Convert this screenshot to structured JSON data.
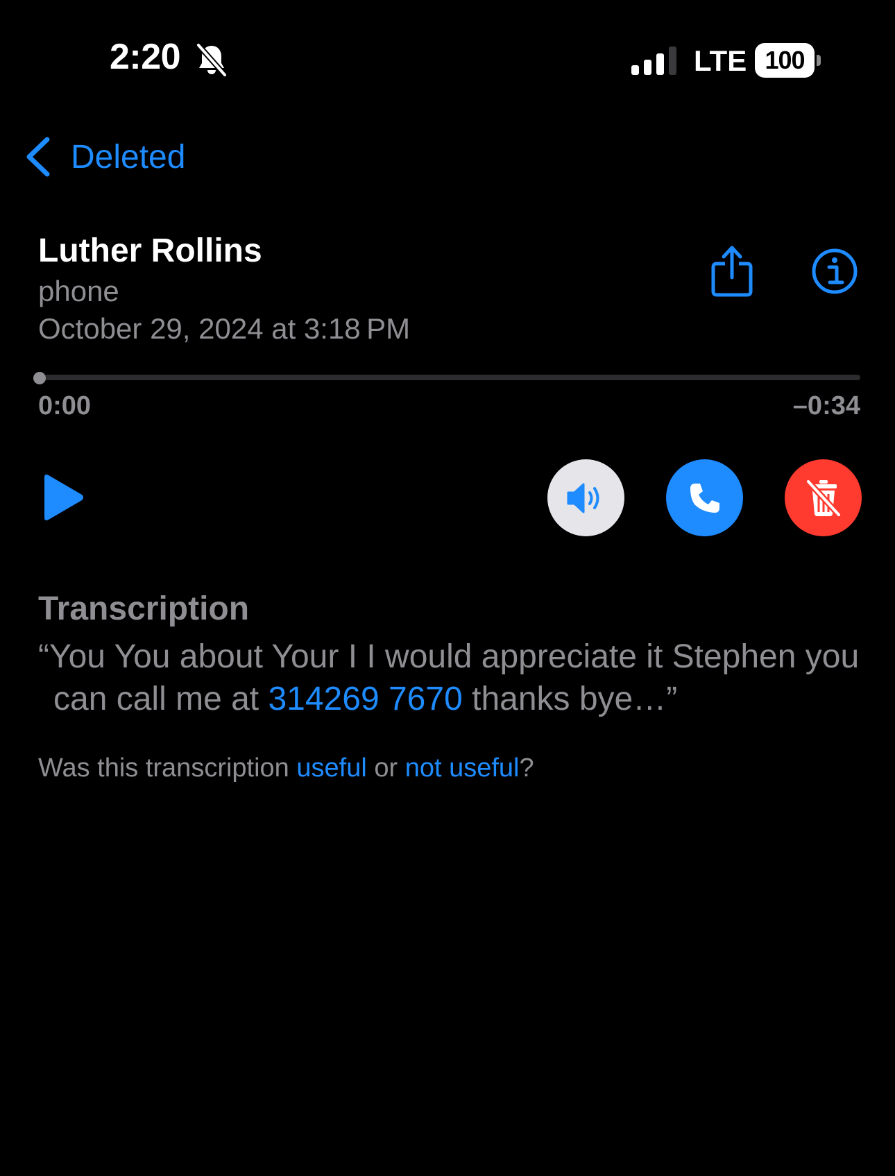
{
  "status_bar": {
    "time": "2:20",
    "network": "LTE",
    "battery": "100",
    "icons": [
      "bell-slash-icon",
      "signal-icon",
      "battery-icon"
    ]
  },
  "nav": {
    "back_label": "Deleted",
    "back_icon": "chevron-left-icon"
  },
  "voicemail": {
    "caller_name": "Luther Rollins",
    "label": "phone",
    "datetime": "October 29, 2024 at 3:18 PM",
    "actions": [
      "share-icon",
      "info-icon"
    ]
  },
  "player": {
    "elapsed": "0:00",
    "remaining": "–0:34",
    "progress": 0,
    "play_icon": "play-icon"
  },
  "controls": {
    "speaker": {
      "icon": "speaker-icon",
      "bg": "#e5e5ea",
      "fg": "#1e8bff"
    },
    "call": {
      "icon": "phone-icon",
      "bg": "#1e8bff",
      "fg": "#ffffff"
    },
    "delete": {
      "icon": "trash-slash-icon",
      "bg": "#ff3b30",
      "fg": "#ffffff"
    }
  },
  "transcription": {
    "heading": "Transcription",
    "text_before": "“You You about Your I I would appreciate it Stephen you can call me at ",
    "phone_link": "314269 7670",
    "text_after": " thanks bye…”"
  },
  "feedback": {
    "prefix": "Was this transcription ",
    "useful_link": "useful",
    "middle": " or ",
    "not_useful_link": "not useful",
    "suffix": "?"
  },
  "colors": {
    "background": "#000000",
    "accent": "#1e8bff",
    "secondary_text": "#8e8e93",
    "destructive": "#ff3b30"
  }
}
